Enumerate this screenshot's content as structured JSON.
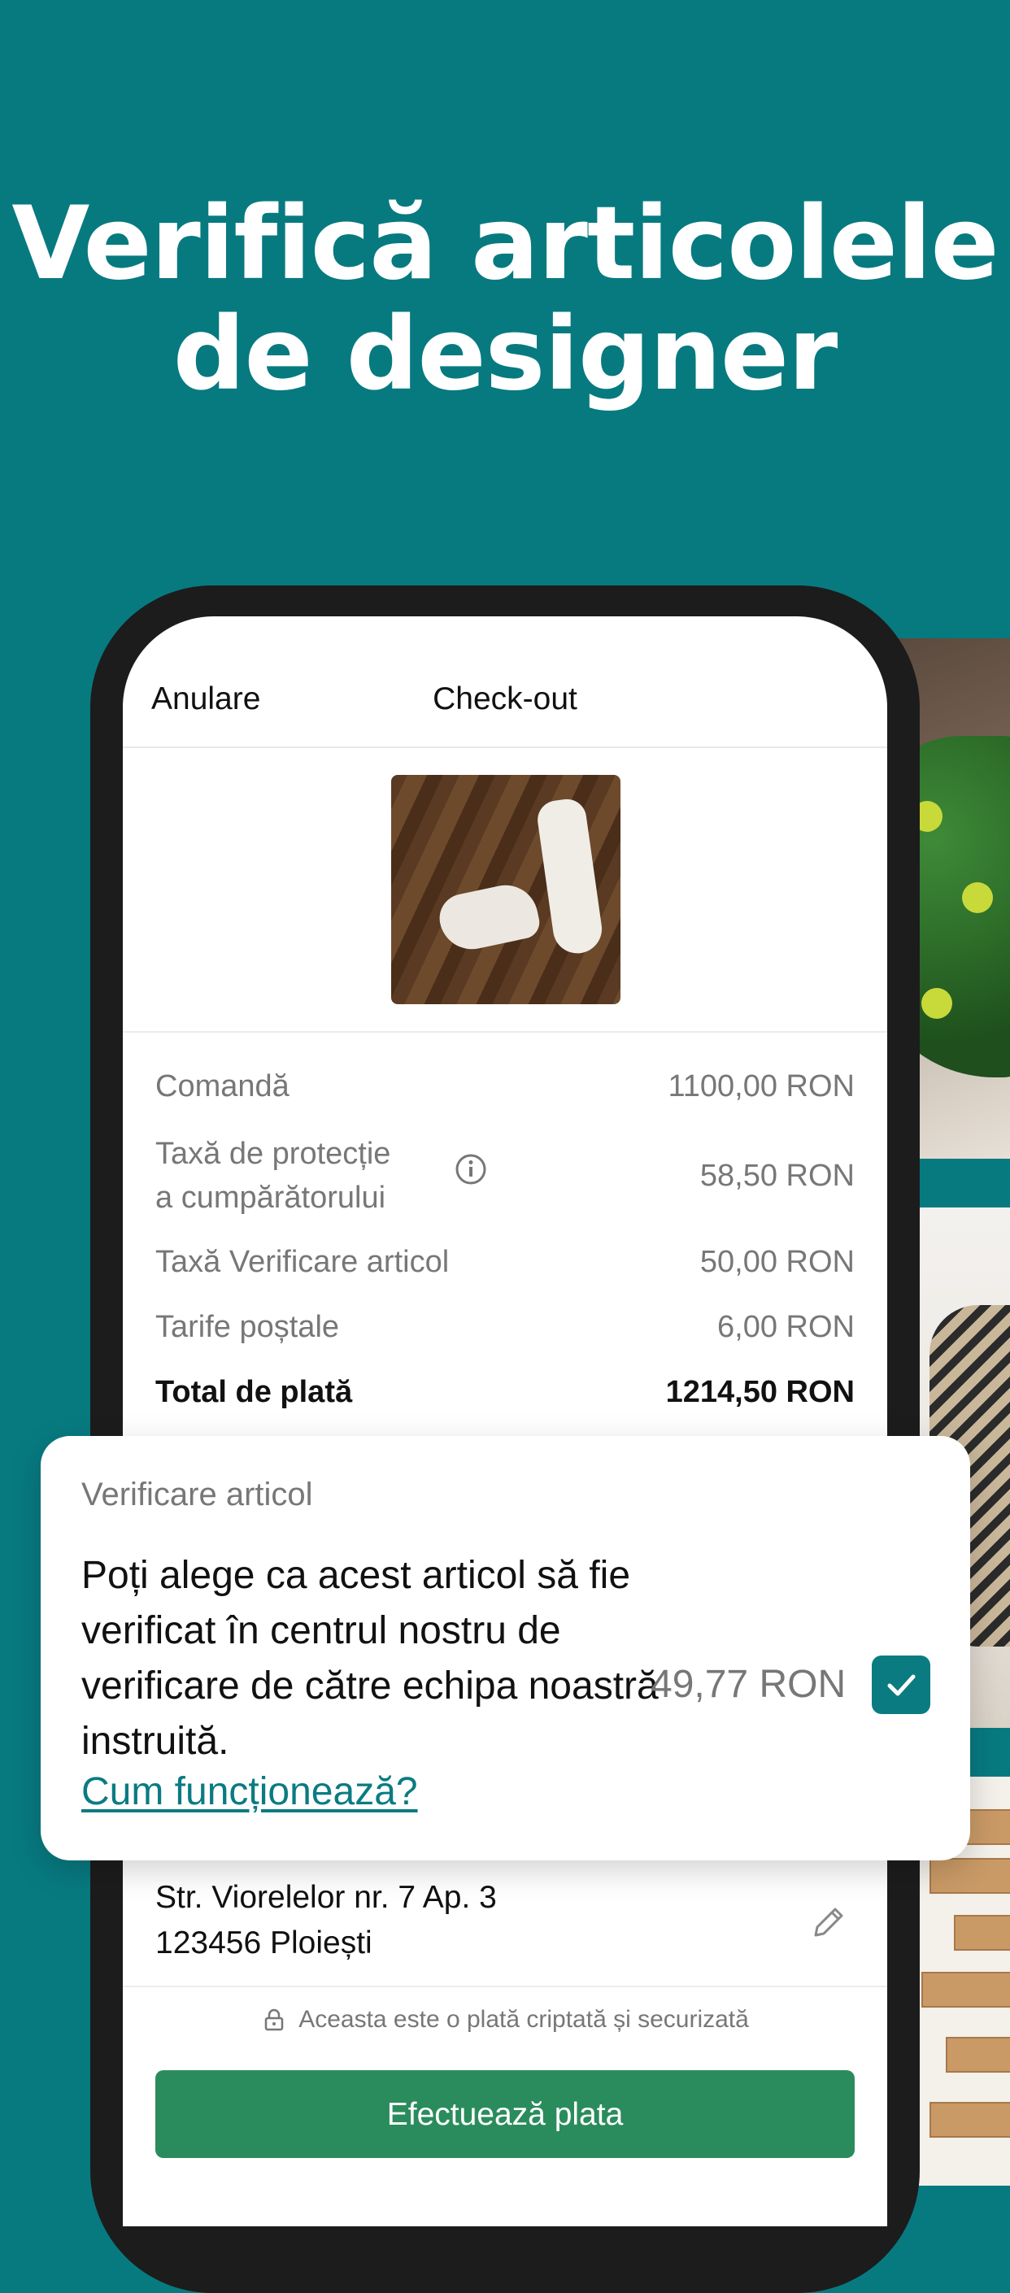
{
  "headline": {
    "line1": "Verifică articolele",
    "line2": "de designer"
  },
  "nav": {
    "cancel_label": "Anulare",
    "title": "Check-out"
  },
  "summary": {
    "rows": [
      {
        "label": "Comandă",
        "value": "1100,00 RON"
      },
      {
        "label_line1": "Taxă de protecție",
        "label_line2": "a cumpărătorului",
        "value": "58,50 RON",
        "icon": "info-icon"
      },
      {
        "label": "Taxă Verificare articol",
        "value": "50,00 RON"
      },
      {
        "label": "Tarife poștale",
        "value": "6,00 RON"
      }
    ],
    "total_label": "Total de plată",
    "total_value": "1214,50 RON"
  },
  "verification_card": {
    "eyebrow": "Verificare articol",
    "body": "Poți alege ca acest articol să fie verificat în centrul nostru de verificare de către echipa noastră instruită.",
    "link": "Cum funcționează?",
    "price": "49,77 RON",
    "checked": true
  },
  "address": {
    "line1": "Str. Viorelelor nr. 7 Ap. 3",
    "line2": "123456 Ploiești",
    "edit_icon": "pencil-icon"
  },
  "secure_note": "Aceasta este o plată criptată și securizată",
  "pay_button": "Efectuează plata",
  "colors": {
    "background": "#077A80",
    "accent": "#0B7B82",
    "pay_button": "#2A8C5C"
  }
}
